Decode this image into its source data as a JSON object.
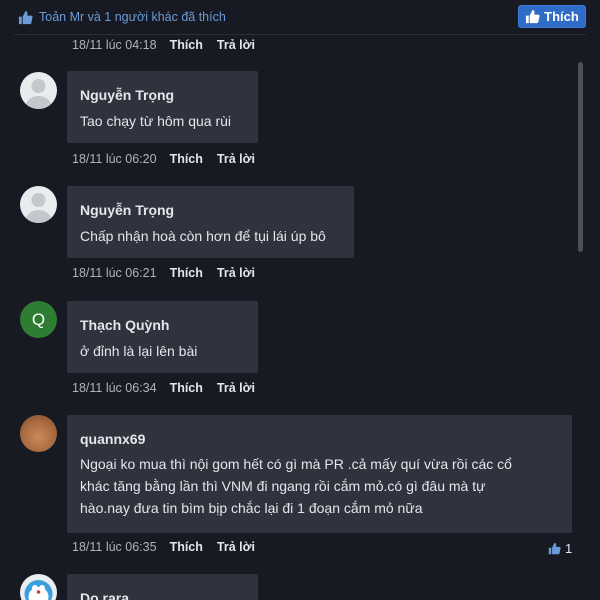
{
  "header": {
    "likes_summary": "Toản Mr và 1 người khác đã thích",
    "like_button_label": "Thích"
  },
  "actions": {
    "like": "Thích",
    "reply": "Trả lời"
  },
  "first_meta_time": "18/11 lúc 04:18",
  "comments": [
    {
      "name": "Nguyễn Trọng",
      "text": "Tao chạy từ hôm qua rùi",
      "time": "18/11 lúc 06:20"
    },
    {
      "name": "Nguyễn Trọng",
      "text": "Chấp nhận hoà còn hơn để tụi lái úp bô",
      "time": "18/11 lúc 06:21"
    },
    {
      "name": "Thạch Quỳnh",
      "avatar_letter": "Q",
      "text": "ở đỉnh là lại lên bài",
      "time": "18/11 lúc 06:34"
    },
    {
      "name": "quannx69",
      "text_lines": [
        "Ngoại ko mua thì nội gom hết có gì mà PR .cả mấy quí vừa rồi các cổ",
        "khác tăng bằng lần thì VNM đi ngang rồi cắm mỏ.có gì đâu mà tự",
        "hào.nay đưa tin bìm bịp chắc lại đi 1 đoạn cắm mỏ nữa"
      ],
      "time": "18/11 lúc 06:35",
      "like_count": "1"
    },
    {
      "name": "Do rara"
    }
  ],
  "colors": {
    "background": "#171a22",
    "bubble": "#2f333d",
    "accent": "#2f6cc7",
    "link": "#6b9bd8"
  },
  "icons": [
    "thumbs-up-icon",
    "default-avatar-icon"
  ]
}
